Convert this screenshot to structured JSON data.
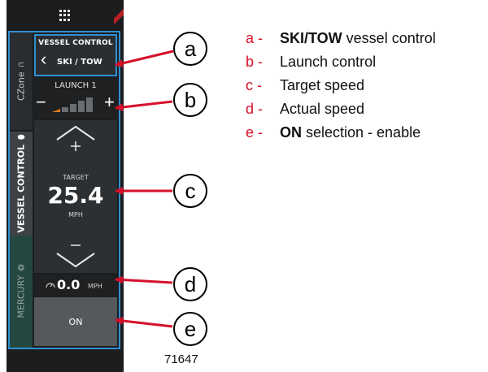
{
  "device": {
    "side_tabs": {
      "czone": "CZone",
      "vessel_control": "VESSEL CONTROL",
      "mercury": "MERCURY"
    },
    "header": {
      "title": "VESSEL CONTROL",
      "mode": "SKI / TOW"
    },
    "launch": {
      "label": "LAUNCH 1",
      "minus": "−",
      "plus": "+",
      "level": 1,
      "max_level": 5
    },
    "target": {
      "label": "TARGET",
      "value": "25.4",
      "unit": "MPH"
    },
    "actual": {
      "value": "0.0",
      "unit": "MPH"
    },
    "on_button": "ON"
  },
  "callouts": [
    "a",
    "b",
    "c",
    "d",
    "e"
  ],
  "legend": [
    {
      "key": "a -",
      "bold": "SKI/TOW",
      "text": " vessel control"
    },
    {
      "key": "b -",
      "bold": "",
      "text": "Launch control"
    },
    {
      "key": "c -",
      "bold": "",
      "text": "Target speed"
    },
    {
      "key": "d -",
      "bold": "",
      "text": "Actual speed"
    },
    {
      "key": "e -",
      "bold": "ON",
      "text": " selection - enable"
    }
  ],
  "figure_number": "71647",
  "colors": {
    "callout_red": "#d5102a",
    "selection_blue": "#2f8fd0",
    "launch_active": "#e07a1f"
  },
  "icons": [
    "apps-grid-icon",
    "link-icon",
    "boat-icon",
    "mercury-logo-icon",
    "back-chevron-icon",
    "up-arrow-icon",
    "down-arrow-icon",
    "speedometer-icon"
  ]
}
